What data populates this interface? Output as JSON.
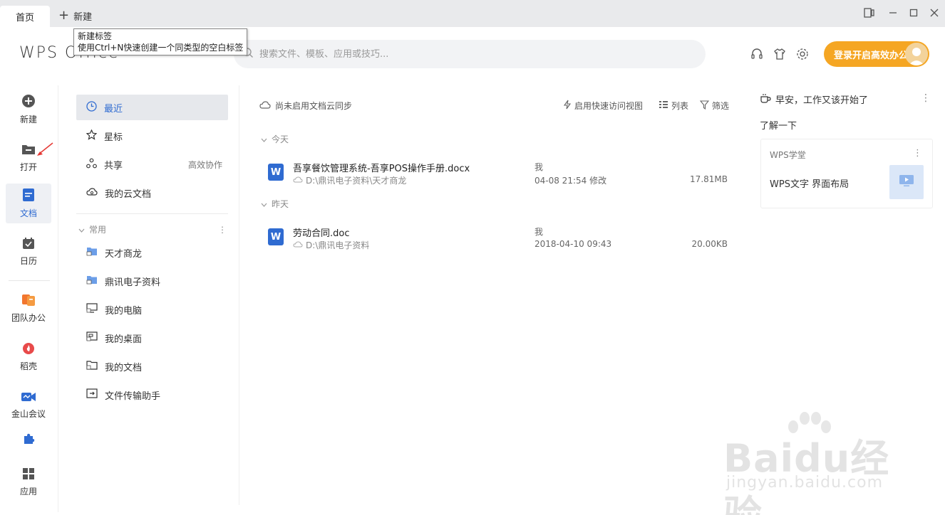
{
  "tabs": {
    "home": "首页",
    "new": "新建"
  },
  "tooltip": {
    "title": "新建标签",
    "desc": "使用Ctrl+N快速创建一个同类型的空白标签"
  },
  "header": {
    "logo": "WPS Office",
    "search_placeholder": "搜索文件、模板、应用或技巧...",
    "login": "登录开启高效办公"
  },
  "rail": [
    {
      "label": "新建"
    },
    {
      "label": "打开"
    },
    {
      "label": "文档"
    },
    {
      "label": "日历"
    },
    {
      "label": "团队办公"
    },
    {
      "label": "稻壳"
    },
    {
      "label": "金山会议"
    },
    {
      "label": "应用"
    }
  ],
  "nav": {
    "recent": "最近",
    "starred": "星标",
    "shared": "共享",
    "shared_right": "高效协作",
    "cloud": "我的云文档",
    "common_header": "常用",
    "common": [
      "天才商龙",
      "鼎讯电子资料",
      "我的电脑",
      "我的桌面",
      "我的文档",
      "文件传输助手"
    ]
  },
  "toolbar": {
    "cloud_sync": "尚未启用文档云同步",
    "quick_view": "启用快速访问视图",
    "list": "列表",
    "filter": "筛选"
  },
  "groups": {
    "today": "今天",
    "yesterday": "昨天"
  },
  "files": [
    {
      "name": "吾享餐饮管理系统-吾享POS操作手册.docx",
      "path": "D:\\鼎讯电子资料\\天才商龙",
      "owner": "我",
      "time": "04-08 21:54 修改",
      "size": "17.81MB"
    },
    {
      "name": "劳动合同.doc",
      "path": "D:\\鼎讯电子资料",
      "owner": "我",
      "time": "2018-04-10 09:43",
      "size": "20.00KB"
    }
  ],
  "right_panel": {
    "greeting": "早安，工作又该开始了",
    "learn": "了解一下",
    "card_title": "WPS学堂",
    "card_text": "WPS文字 界面布局"
  },
  "watermark": {
    "main": "Baidu经验",
    "sub": "jingyan.baidu.com"
  },
  "colors": {
    "accent": "#2f6bd1",
    "login": "#f5a623"
  }
}
